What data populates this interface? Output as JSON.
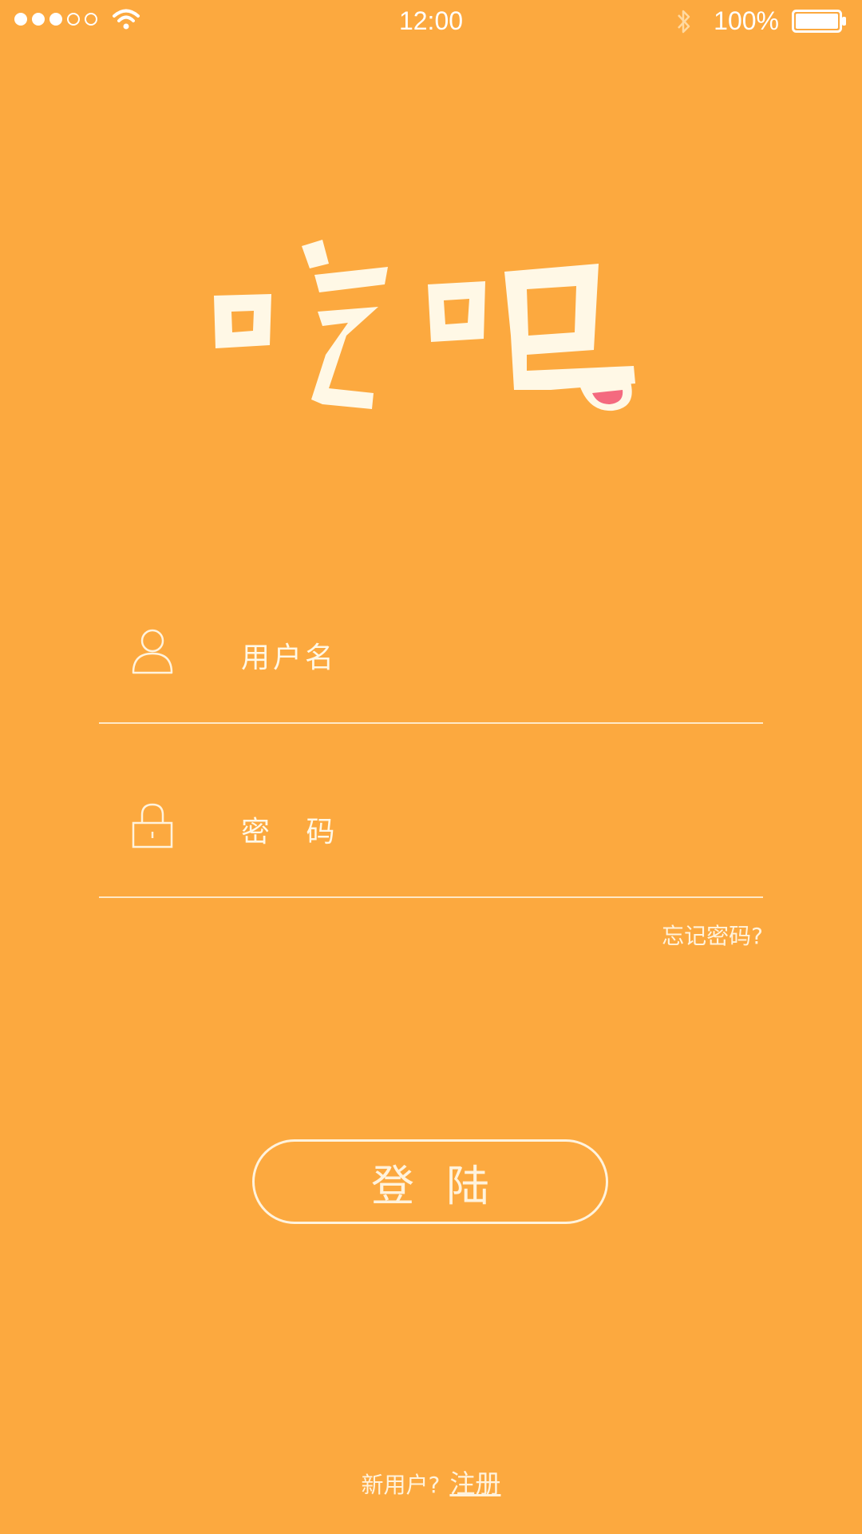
{
  "status_bar": {
    "time": "12:00",
    "battery": "100%",
    "signal_icon": "signal-dots-icon",
    "wifi_icon": "wifi-icon",
    "bluetooth_icon": "bluetooth-icon",
    "battery_icon": "battery-icon"
  },
  "logo": {
    "text": "吃吧"
  },
  "form": {
    "username_placeholder": "用户名",
    "password_placeholder": "密 码",
    "forgot": "忘记密码?"
  },
  "login_button": "登陆",
  "footer": {
    "new_user": "新用户?",
    "register": "注册"
  },
  "colors": {
    "background": "#FCA93F",
    "logo": "#FFF8E6",
    "tongue": "#F46A7F"
  }
}
